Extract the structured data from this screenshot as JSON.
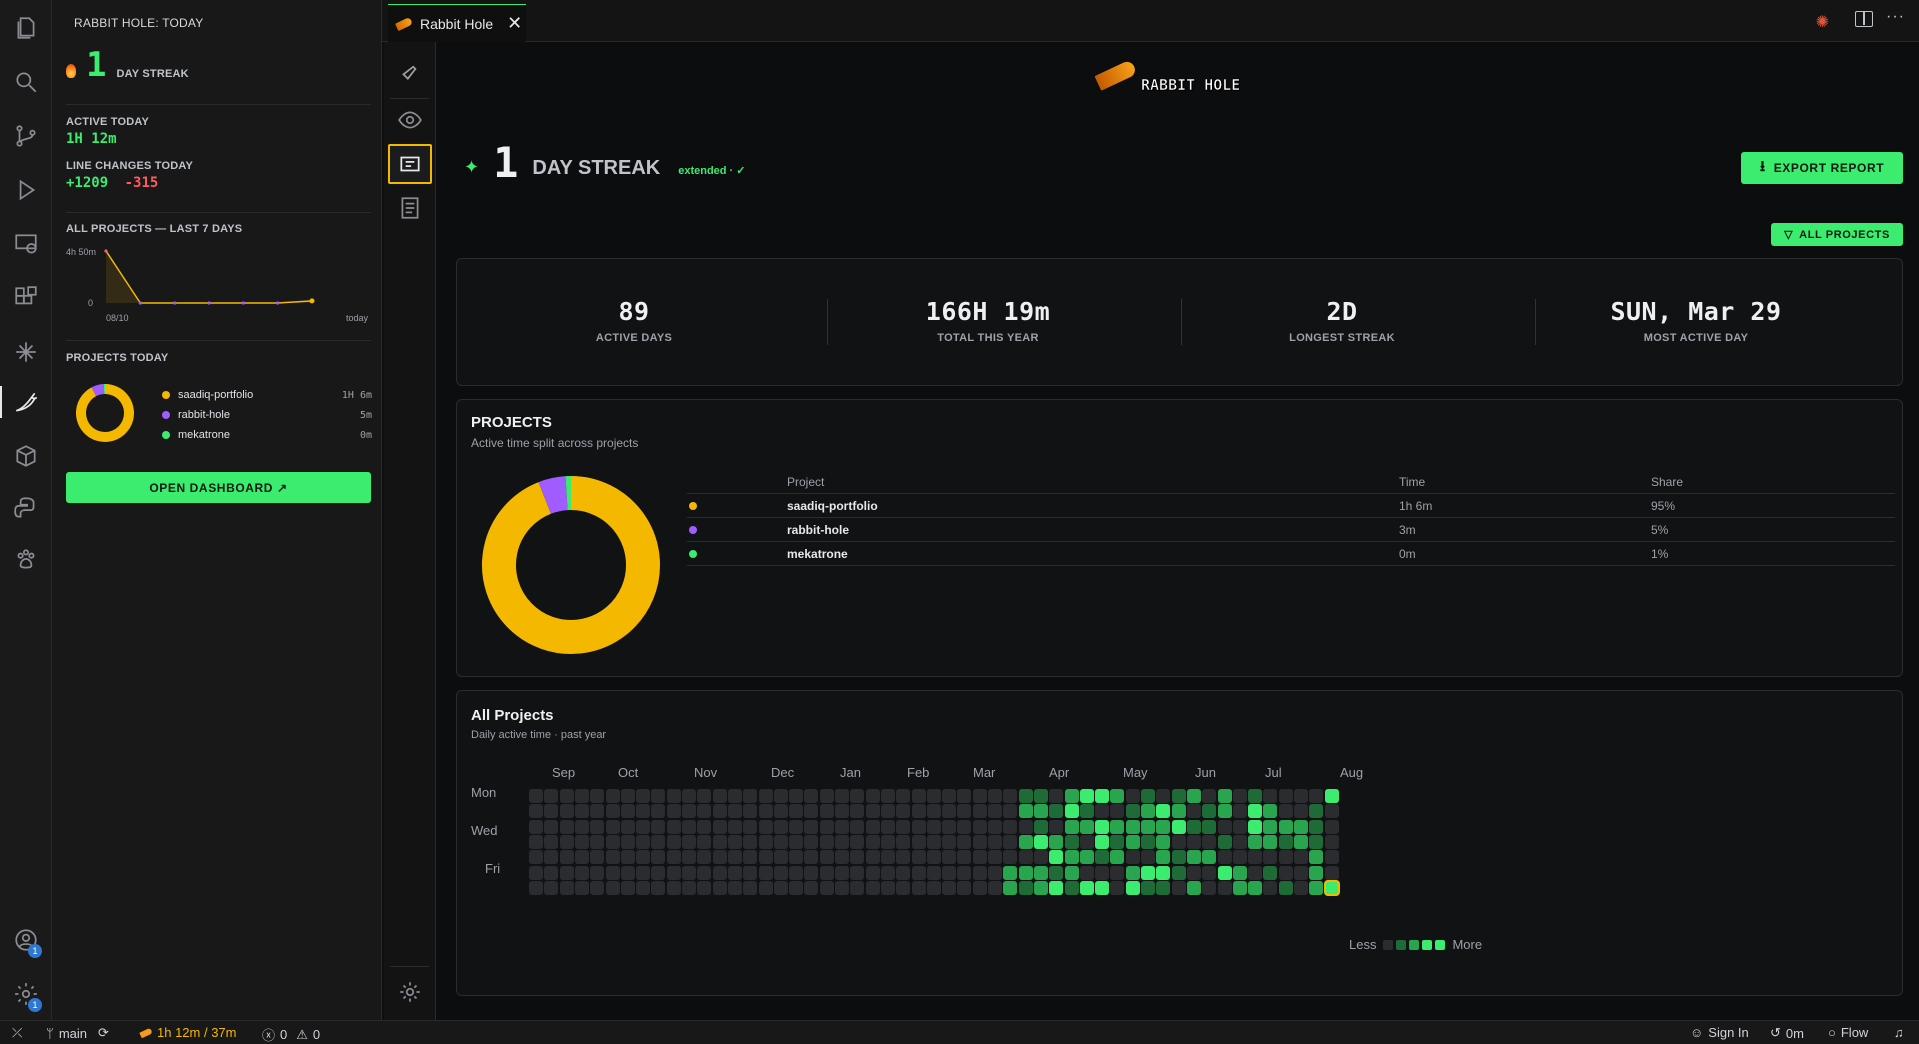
{
  "sidebar": {
    "title": "RABBIT HOLE: TODAY",
    "streak_number": "1",
    "streak_label": "DAY STREAK",
    "active_today_label": "ACTIVE TODAY",
    "active_today_value": "1H 12m",
    "line_changes_label": "LINE CHANGES TODAY",
    "lines_added": "+1209",
    "lines_removed": "-315",
    "projects_7d_label": "ALL PROJECTS — LAST 7 DAYS",
    "spark_ymax": "4h 50m",
    "spark_ymin": "0",
    "spark_x_start": "08/10",
    "spark_x_end": "today",
    "spark_values": [
      4.83,
      0.0,
      0.0,
      0.0,
      0.0,
      0.0,
      0.2
    ],
    "projects_today_label": "PROJECTS TODAY",
    "projects_today": [
      {
        "name": "saadiq-portfolio",
        "time": "1H 6m",
        "color": "#f5b800"
      },
      {
        "name": "rabbit-hole",
        "time": "5m",
        "color": "#a05cff"
      },
      {
        "name": "mekatrone",
        "time": "0m",
        "color": "#3bec6f"
      }
    ],
    "open_dashboard": "OPEN DASHBOARD ↗"
  },
  "tab": {
    "label": "Rabbit Hole"
  },
  "header": {
    "logo_text": "RABBIT HOLE",
    "streak_number": "1",
    "streak_label": "DAY STREAK",
    "extended_text": "extended · ✓",
    "export_label": "EXPORT REPORT",
    "filter_label": "ALL PROJECTS"
  },
  "stats": [
    {
      "value": "89",
      "label": "ACTIVE DAYS"
    },
    {
      "value": "166H 19m",
      "label": "TOTAL THIS YEAR"
    },
    {
      "value": "2D",
      "label": "LONGEST STREAK"
    },
    {
      "value": "SUN, Mar 29",
      "label": "MOST ACTIVE DAY"
    }
  ],
  "projects": {
    "title": "PROJECTS",
    "subtitle": "Active time split across projects",
    "col_project": "Project",
    "col_time": "Time",
    "col_share": "Share",
    "rows": [
      {
        "name": "saadiq-portfolio",
        "time": "1h 6m",
        "share": "95%",
        "color": "#f5b800"
      },
      {
        "name": "rabbit-hole",
        "time": "3m",
        "share": "5%",
        "color": "#a05cff"
      },
      {
        "name": "mekatrone",
        "time": "0m",
        "share": "1%",
        "color": "#3bec6f"
      }
    ],
    "donut_shares": [
      95,
      5,
      1
    ]
  },
  "heatmap": {
    "title": "All Projects",
    "subtitle": "Daily active time · past year",
    "months": [
      "Sep",
      "Oct",
      "Nov",
      "Dec",
      "Jan",
      "Feb",
      "Mar",
      "Apr",
      "May",
      "Jun",
      "Jul",
      "Aug"
    ],
    "days": [
      "Mon",
      "Wed",
      "Fri"
    ],
    "less": "Less",
    "more": "More",
    "colors": [
      "#2a2c2f",
      "#1f6b37",
      "#2aa54f",
      "#3bec6f"
    ]
  },
  "status": {
    "branch": "main",
    "time": "1h 12m / 37m",
    "errors": "0",
    "warnings": "0",
    "sign_in": "Sign In",
    "timer": "0m",
    "flow": "Flow"
  }
}
